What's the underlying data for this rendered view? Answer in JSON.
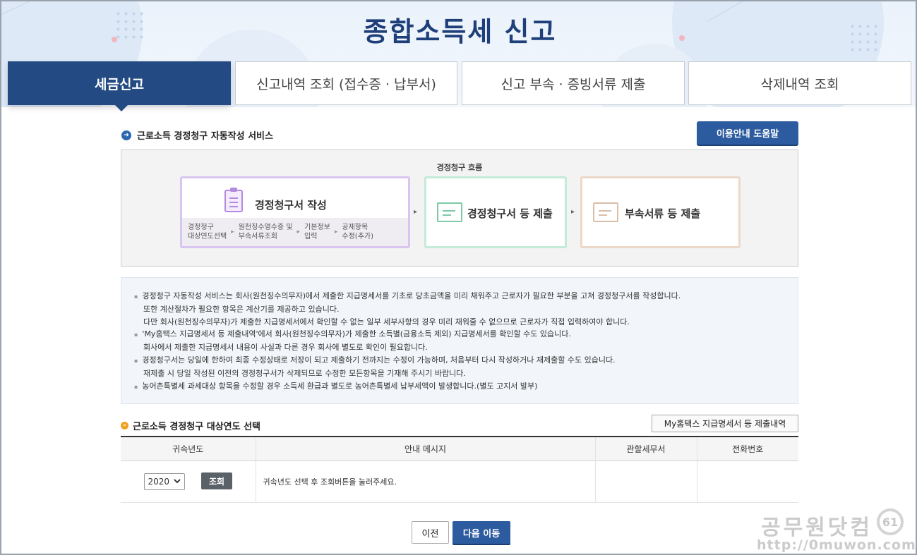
{
  "page_title": "종합소득세 신고",
  "tabs": [
    {
      "label": "세금신고",
      "active": true
    },
    {
      "label": "신고내역 조회 (접수증 · 납부서)",
      "active": false
    },
    {
      "label": "신고 부속 · 증빙서류 제출",
      "active": false
    },
    {
      "label": "삭제내역 조회",
      "active": false
    }
  ],
  "service": {
    "title": "근로소득 경정청구 자동작성 서비스",
    "help_button": "이용안내 도움말"
  },
  "flow": {
    "label": "경정청구 흐름",
    "step1": {
      "title": "경정청구서 작성",
      "sub_steps": [
        {
          "line1": "경정청구",
          "line2": "대상연도선택"
        },
        {
          "line1": "원천징수영수증 및",
          "line2": "부속서류조회"
        },
        {
          "line1": "기본정보",
          "line2": "입력"
        },
        {
          "line1": "공제항목",
          "line2": "수정(추가)"
        }
      ]
    },
    "step2": {
      "title": "경정청구서 등 제출"
    },
    "step3": {
      "title": "부속서류 등 제출"
    },
    "arrow": "▸"
  },
  "info": {
    "lines": [
      "경정청구 자동작성 서비스는 회사(원천징수의무자)에서 제출한 지급명세서를 기초로 당초금액을 미리 채워주고 근로자가 필요한 부분을 고쳐 경정청구서를 작성합니다.",
      "또한 계산절차가 필요한 항목은 계산기를 제공하고 있습니다.",
      "다만 회사(원천징수의무자)가 제출한 지급명세서에서 확인할 수 없는 일부 세부사항의 경우 미리 채워줄 수 없으므로 근로자가 직접 입력하여야 합니다.",
      "'My홈택스 지급명세서 등 제출내역'에서 회사(원천징수의무자)가 제출한 소득별(금융소득 제외) 지급명세서를 확인할 수도 있습니다.",
      "회사에서 제출한 지급명세서 내용이 사실과 다른 경우 회사에 별도로 확인이 필요합니다.",
      "경정청구서는 당일에 한하여 최종 수정상태로 저장이 되고 제출하기 전까지는 수정이 가능하며, 처음부터 다시 작성하거나 재제출할 수도 있습니다.",
      "재제출 시 당일 작성된 이전의 경정청구서가 삭제되므로 수정한 모든항목을 기재해 주시기 바랍니다.",
      "농어촌특별세 과세대상 항목을 수정할 경우 소득세 환급과 별도로 농어촌특별세 납부세액이 발생합니다.(별도 고지서 발부)"
    ]
  },
  "year_select": {
    "title": "근로소득 경정청구 대상연도 선택",
    "statement_button": "My홈택스 지급명세서 등 제출내역",
    "table": {
      "headers": [
        "귀속년도",
        "안내 메시지",
        "관할세무서",
        "전화번호"
      ],
      "year_value": "2020",
      "query_button": "조회",
      "message": "귀속년도 선택 후 조회버튼을 눌러주세요.",
      "tax_office": "",
      "phone": ""
    }
  },
  "nav": {
    "prev_button": "이전",
    "next_button": "다음 이동"
  },
  "watermark": {
    "text": "공무원닷컴",
    "logo": "61",
    "url": "http://0muwon.com"
  },
  "colors": {
    "primary": "#234a83",
    "button_blue": "#2c5b9f",
    "step1_border": "#d9c6f0",
    "step2_border": "#c4ead8",
    "step3_border": "#ecd8c8"
  }
}
